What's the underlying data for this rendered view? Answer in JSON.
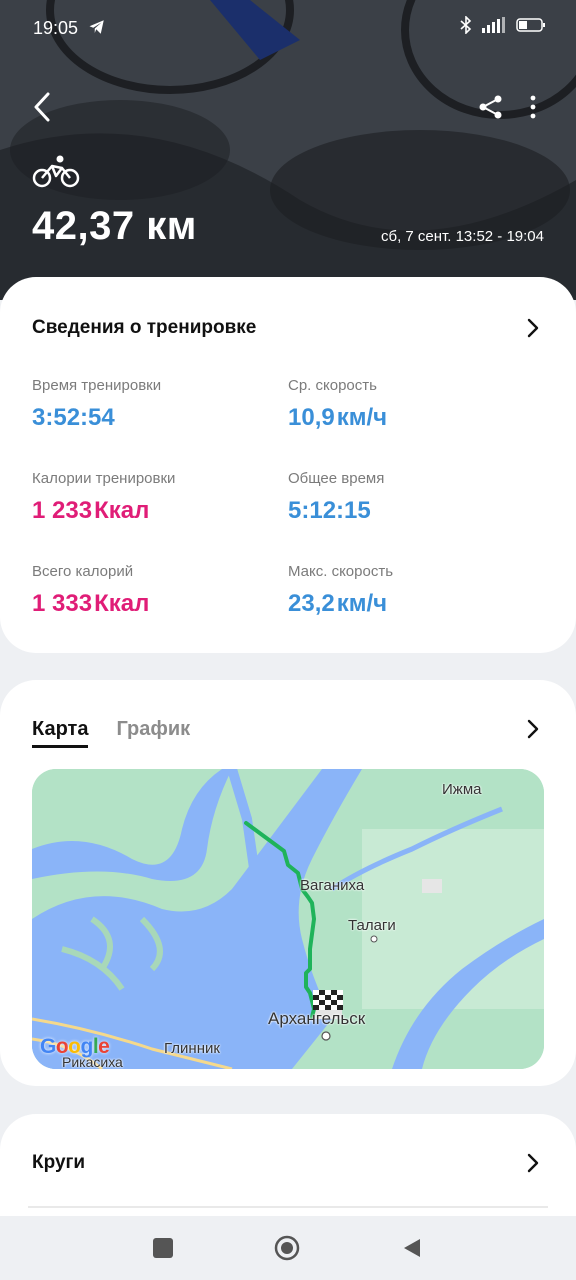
{
  "status": {
    "time": "19:05"
  },
  "header": {
    "distance": "42,37 км",
    "date_range": "сб, 7 сент. 13:52 - 19:04"
  },
  "details": {
    "title": "Сведения о тренировке",
    "stats": [
      {
        "label": "Время тренировки",
        "value": "3:52:54",
        "unit": ""
      },
      {
        "label": "Ср. скорость",
        "value": "10,9",
        "unit": "км/ч"
      },
      {
        "label": "Калории тренировки",
        "value": "1 233",
        "unit": "Ккал"
      },
      {
        "label": "Общее время",
        "value": "5:12:15",
        "unit": ""
      },
      {
        "label": "Всего калорий",
        "value": "1 333",
        "unit": "Ккал"
      },
      {
        "label": "Макс. скорость",
        "value": "23,2",
        "unit": "км/ч"
      }
    ]
  },
  "map_card": {
    "tabs": [
      "Карта",
      "График"
    ],
    "places": [
      "Ижма",
      "Ваганиха",
      "Талаги",
      "Архангельск",
      "Глинник",
      "Рикасиха"
    ],
    "attribution": "Google",
    "colors": {
      "route": "#1fb35a",
      "water": "#8ab4f8",
      "land": "#aee0c2"
    }
  },
  "laps": {
    "title": "Круги"
  },
  "colors": {
    "blue": "#3a8fd8",
    "pink": "#e01d77"
  }
}
